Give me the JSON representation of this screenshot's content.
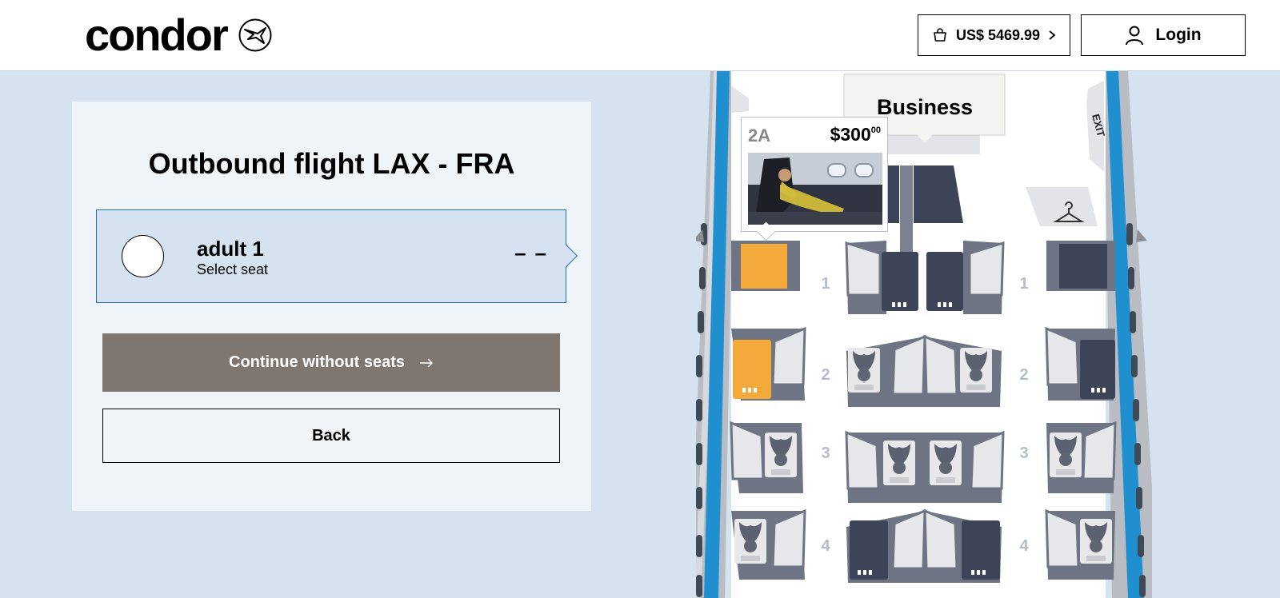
{
  "header": {
    "logo_text": "condor",
    "cart_label": "US$ 5469.99",
    "login_label": "Login"
  },
  "panel": {
    "title": "Outbound flight LAX - FRA",
    "passenger": {
      "name": "adult 1",
      "status": "Select seat",
      "seat": "– –"
    },
    "continue_label": "Continue without seats",
    "back_label": "Back"
  },
  "seatmap": {
    "cabin_label": "Business",
    "exit_label": "EXIT",
    "rows": [
      "1",
      "2",
      "3",
      "4"
    ],
    "tooltip": {
      "seat": "2A",
      "price": "$300",
      "price_cents": "00"
    }
  },
  "colors": {
    "background": "#d5e2ef",
    "selected_seat": "#f4a93b",
    "occupied_seat": "#3d4457",
    "continue_button": "#7f7670",
    "passenger_border": "#2b6cb0",
    "fuselage_stripe": "#1f8fd0"
  }
}
